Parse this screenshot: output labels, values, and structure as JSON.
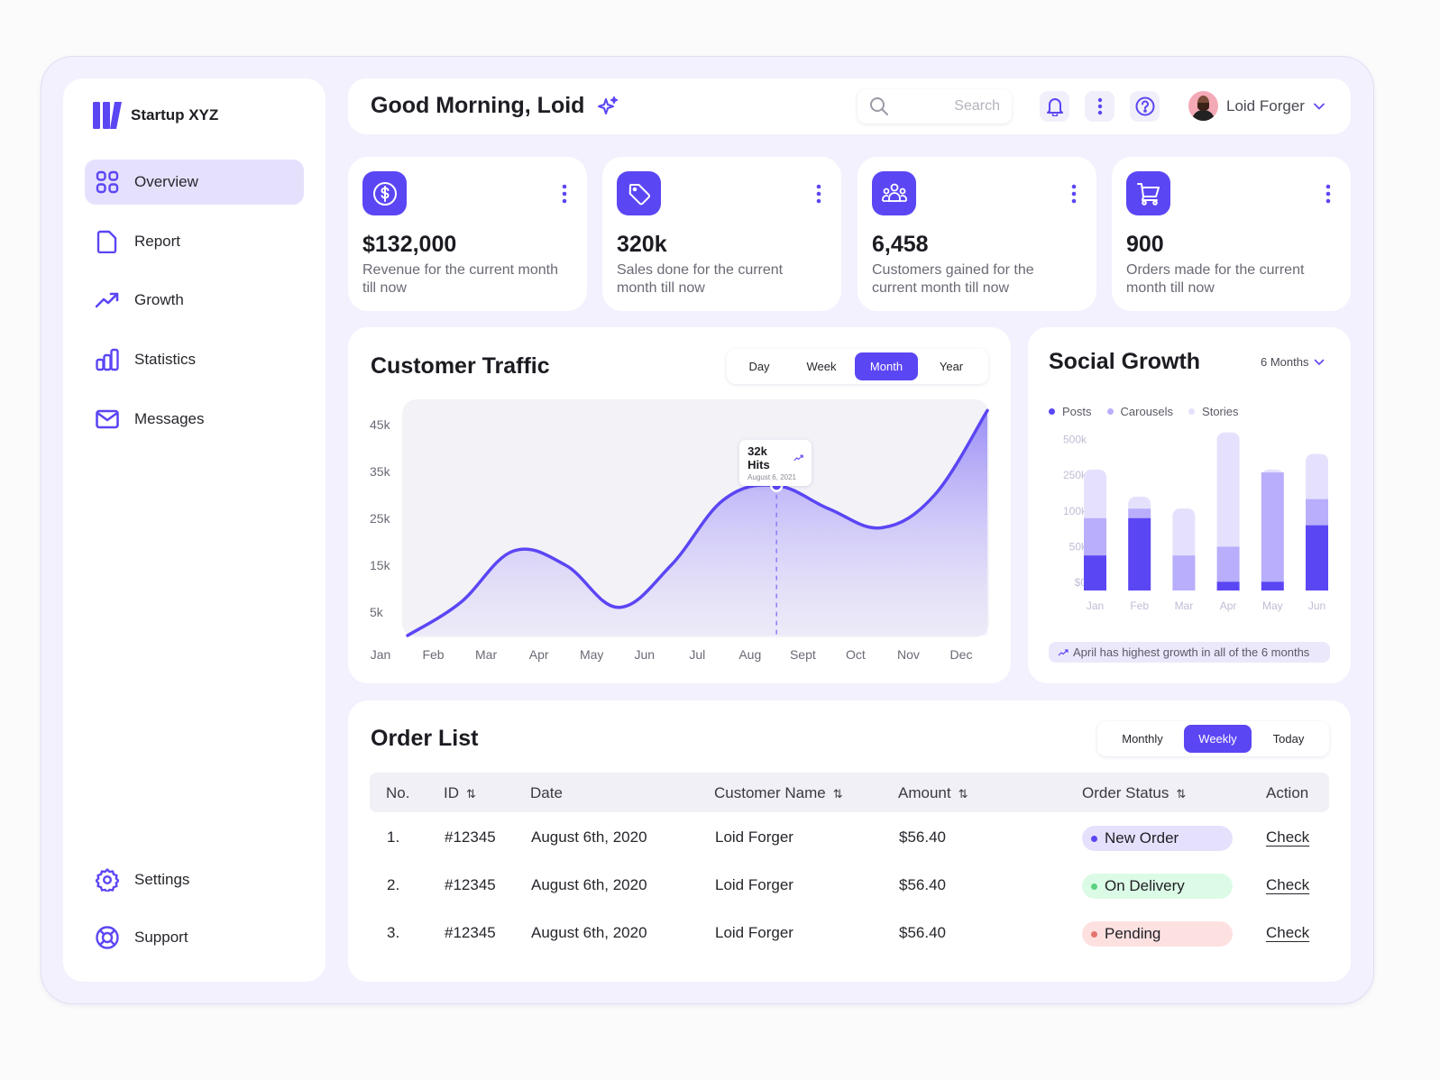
{
  "brand": {
    "name": "Startup XYZ",
    "accent": "#5b46f4"
  },
  "sidebar": {
    "items": [
      {
        "label": "Overview",
        "icon": "grid-icon",
        "active": true
      },
      {
        "label": "Report",
        "icon": "document-icon"
      },
      {
        "label": "Growth",
        "icon": "trending-up-icon"
      },
      {
        "label": "Statistics",
        "icon": "bar-chart-icon"
      },
      {
        "label": "Messages",
        "icon": "mail-icon"
      }
    ],
    "bottom": [
      {
        "label": "Settings",
        "icon": "gear-icon"
      },
      {
        "label": "Support",
        "icon": "lifebuoy-icon"
      }
    ]
  },
  "header": {
    "greeting": "Good Morning, Loid",
    "search_placeholder": "Search",
    "user_name": "Loid Forger"
  },
  "stats": [
    {
      "value": "$132,000",
      "desc": "Revenue for the current month till now",
      "icon": "dollar-icon"
    },
    {
      "value": "320k",
      "desc": "Sales done for the current month till now",
      "icon": "tag-icon"
    },
    {
      "value": "6,458",
      "desc": "Customers gained for the current month till now",
      "icon": "users-icon"
    },
    {
      "value": "900",
      "desc": "Orders made for the current month till now",
      "icon": "cart-icon"
    }
  ],
  "traffic": {
    "title": "Customer Traffic",
    "ranges": [
      "Day",
      "Week",
      "Month",
      "Year"
    ],
    "selected_range": "Month",
    "tooltip": {
      "value": "32k Hits",
      "date": "August 6, 2021"
    }
  },
  "social": {
    "title": "Social Growth",
    "period": "6 Months",
    "note": "April has highest growth in all of the 6 months"
  },
  "orders": {
    "title": "Order List",
    "filters": [
      "Monthly",
      "Weekly",
      "Today"
    ],
    "selected_filter": "Weekly",
    "columns": [
      "No.",
      "ID",
      "Date",
      "Customer Name",
      "Amount",
      "Order Status",
      "Action"
    ],
    "rows": [
      {
        "no": "1.",
        "id": "#12345",
        "date": "August 6th, 2020",
        "customer": "Loid Forger",
        "amount": "$56.40",
        "status": "New Order",
        "action": "Check"
      },
      {
        "no": "2.",
        "id": "#12345",
        "date": "August 6th, 2020",
        "customer": "Loid Forger",
        "amount": "$56.40",
        "status": "On Delivery",
        "action": "Check"
      },
      {
        "no": "3.",
        "id": "#12345",
        "date": "August 6th, 2020",
        "customer": "Loid Forger",
        "amount": "$56.40",
        "status": "Pending",
        "action": "Check"
      }
    ],
    "status_colors": {
      "New Order": {
        "bg": "#e5e1fd",
        "dot": "#5b46f4"
      },
      "On Delivery": {
        "bg": "#dcfbe6",
        "dot": "#5ad27f"
      },
      "Pending": {
        "bg": "#fde1e1",
        "dot": "#e3746c"
      }
    }
  },
  "chart_data": [
    {
      "type": "area",
      "title": "Customer Traffic",
      "categories": [
        "Jan",
        "Feb",
        "Mar",
        "Apr",
        "May",
        "Jun",
        "Jul",
        "Aug",
        "Sept",
        "Oct",
        "Nov",
        "Dec"
      ],
      "values": [
        0,
        7000,
        18000,
        15000,
        6000,
        15000,
        29000,
        32000,
        27000,
        23000,
        30000,
        48000
      ],
      "yticks": [
        "5k",
        "15k",
        "25k",
        "35k",
        "45k"
      ],
      "ytick_values": [
        5000,
        15000,
        25000,
        35000,
        45000
      ],
      "ylim": [
        0,
        50000
      ],
      "highlight": {
        "category": "Aug",
        "value": 32000,
        "label": "32k Hits",
        "sub": "August 6, 2021"
      },
      "grid": false
    },
    {
      "type": "bar",
      "stacked": true,
      "title": "Social Growth",
      "categories": [
        "Jan",
        "Feb",
        "Mar",
        "Apr",
        "May",
        "Jun"
      ],
      "yticks": [
        "$0",
        "50k",
        "100k",
        "250k",
        "500k"
      ],
      "ytick_values": [
        0,
        50000,
        100000,
        250000,
        500000
      ],
      "scale": "ticks-equally-spaced",
      "series": [
        {
          "name": "Posts",
          "color": "#5b46f4",
          "cumulative": [
            40000,
            90000,
            0,
            10000,
            10000,
            80000
          ]
        },
        {
          "name": "Carousels",
          "color": "#b8aefb",
          "cumulative": [
            90000,
            110000,
            40000,
            50000,
            270000,
            150000
          ]
        },
        {
          "name": "Stories",
          "color": "#e5e1fd",
          "cumulative": [
            290000,
            160000,
            110000,
            550000,
            290000,
            400000
          ]
        }
      ],
      "legend": "top-left"
    }
  ]
}
